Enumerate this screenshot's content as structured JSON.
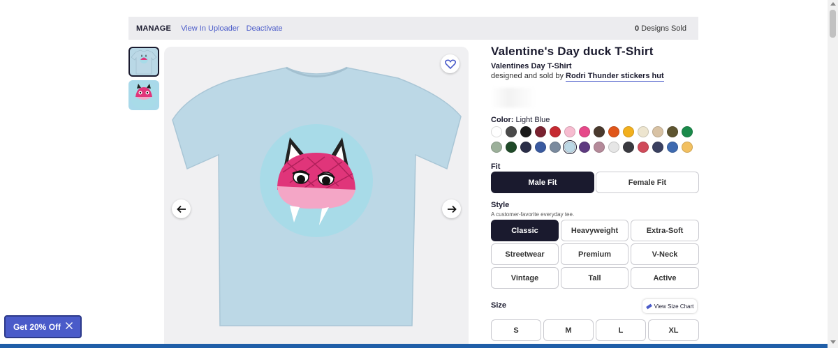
{
  "manage_bar": {
    "manage_label": "MANAGE",
    "view_uploader": "View In Uploader",
    "deactivate": "Deactivate",
    "sold_count": "0",
    "sold_label": "Designs Sold"
  },
  "product": {
    "title": "Valentine's Day duck T-Shirt",
    "subtitle": "Valentines Day T-Shirt",
    "byline_prefix": "designed and sold by",
    "shop_name": "Rodri Thunder stickers hut",
    "shirt_color": "#bcd8e6"
  },
  "color": {
    "label": "Color:",
    "selected": "Light Blue",
    "swatches": [
      {
        "name": "White",
        "hex": "#ffffff"
      },
      {
        "name": "Dark Gray",
        "hex": "#4a4a4a"
      },
      {
        "name": "Black",
        "hex": "#1a1a1a"
      },
      {
        "name": "Maroon",
        "hex": "#7a2230"
      },
      {
        "name": "Red",
        "hex": "#c62a32"
      },
      {
        "name": "Light Pink",
        "hex": "#f7bcd0"
      },
      {
        "name": "Hot Pink",
        "hex": "#e6498a"
      },
      {
        "name": "Brown",
        "hex": "#4a3a2e"
      },
      {
        "name": "Orange",
        "hex": "#e0561a"
      },
      {
        "name": "Gold",
        "hex": "#f2b01e"
      },
      {
        "name": "Cream",
        "hex": "#ede5cf"
      },
      {
        "name": "Tan",
        "hex": "#d8c2a4"
      },
      {
        "name": "Olive",
        "hex": "#5e5530"
      },
      {
        "name": "Kelly Green",
        "hex": "#1a8a4a"
      },
      {
        "name": "Sage",
        "hex": "#9cb09a"
      },
      {
        "name": "Forest Green",
        "hex": "#1f4a28"
      },
      {
        "name": "Navy",
        "hex": "#2a2e48"
      },
      {
        "name": "Royal Blue",
        "hex": "#3a5aa0"
      },
      {
        "name": "Slate",
        "hex": "#7a8a9e"
      },
      {
        "name": "Light Blue",
        "hex": "#bcd8e6",
        "selected": true
      },
      {
        "name": "Purple",
        "hex": "#5e3a80"
      },
      {
        "name": "Mauve",
        "hex": "#b58a9a"
      },
      {
        "name": "Heather White",
        "hex": "#e6e6e6"
      },
      {
        "name": "Charcoal",
        "hex": "#3a3a40"
      },
      {
        "name": "Heather Red",
        "hex": "#d04a5a"
      },
      {
        "name": "Heather Navy",
        "hex": "#3a4060"
      },
      {
        "name": "Heather Blue",
        "hex": "#3e6ab0"
      },
      {
        "name": "Tie Dye",
        "hex": "#f2c060"
      }
    ]
  },
  "fit": {
    "label": "Fit",
    "options": [
      "Male Fit",
      "Female Fit"
    ],
    "selected": "Male Fit"
  },
  "style": {
    "label": "Style",
    "description": "A customer-favorite everyday tee.",
    "options": [
      "Classic",
      "Heavyweight",
      "Extra-Soft",
      "Streetwear",
      "Premium",
      "V-Neck",
      "Vintage",
      "Tall",
      "Active"
    ],
    "selected": "Classic"
  },
  "size": {
    "label": "Size",
    "chart_button": "View Size Chart",
    "options": [
      "S",
      "M",
      "L",
      "XL"
    ]
  },
  "promo": {
    "label": "Get 20% Off"
  }
}
